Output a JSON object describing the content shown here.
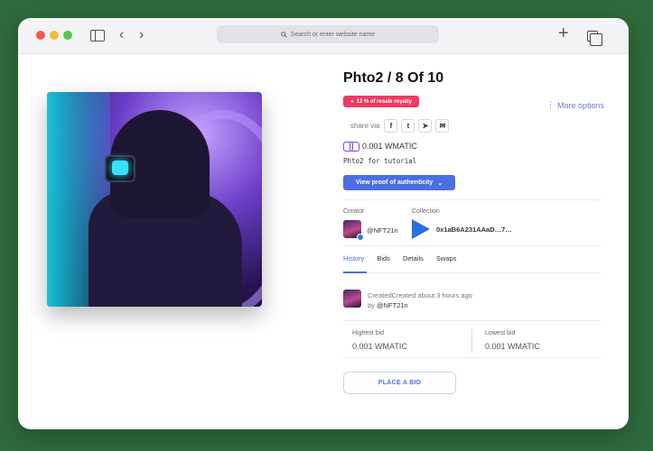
{
  "browser": {
    "url_placeholder": "Search or enter website name",
    "back_glyph": "‹",
    "forward_glyph": "›",
    "new_tab_glyph": "+"
  },
  "nft": {
    "title": "Phto2 / 8 Of 10",
    "royalty_badge": "12 % of resale royalty",
    "more_options": "More options",
    "share_label": "share via",
    "share_buttons": [
      {
        "icon": "facebook-icon",
        "glyph": "f"
      },
      {
        "icon": "twitter-icon",
        "glyph": "t"
      },
      {
        "icon": "telegram-icon",
        "glyph": "➤"
      },
      {
        "icon": "email-icon",
        "glyph": "✉"
      }
    ],
    "price": "0.001 WMATIC",
    "description": "Phto2 for tutorial",
    "proof_button": "View proof of authenticity",
    "proof_chevron": "⌄"
  },
  "creator": {
    "label": "Creator",
    "username": "@NFT21n"
  },
  "collection": {
    "label": "Collection",
    "address": "0x1aB6A231AAaD…7…"
  },
  "tabs": [
    "History",
    "Bids",
    "Details",
    "Swaps"
  ],
  "history": {
    "line1": "CreatedCreated about 3 hours ago",
    "by_prefix": "by",
    "by_user": "@NFT21n"
  },
  "bids": {
    "highest_label": "Highest bid",
    "highest_value": "0.001 WMATIC",
    "lowest_label": "Lowest bid",
    "lowest_value": "0.001 WMATIC"
  },
  "place_bid_label": "PLACE A BID",
  "colors": {
    "accent": "#4a6fe3",
    "royalty": "#ee3b62",
    "polygon": "#8247e5"
  }
}
